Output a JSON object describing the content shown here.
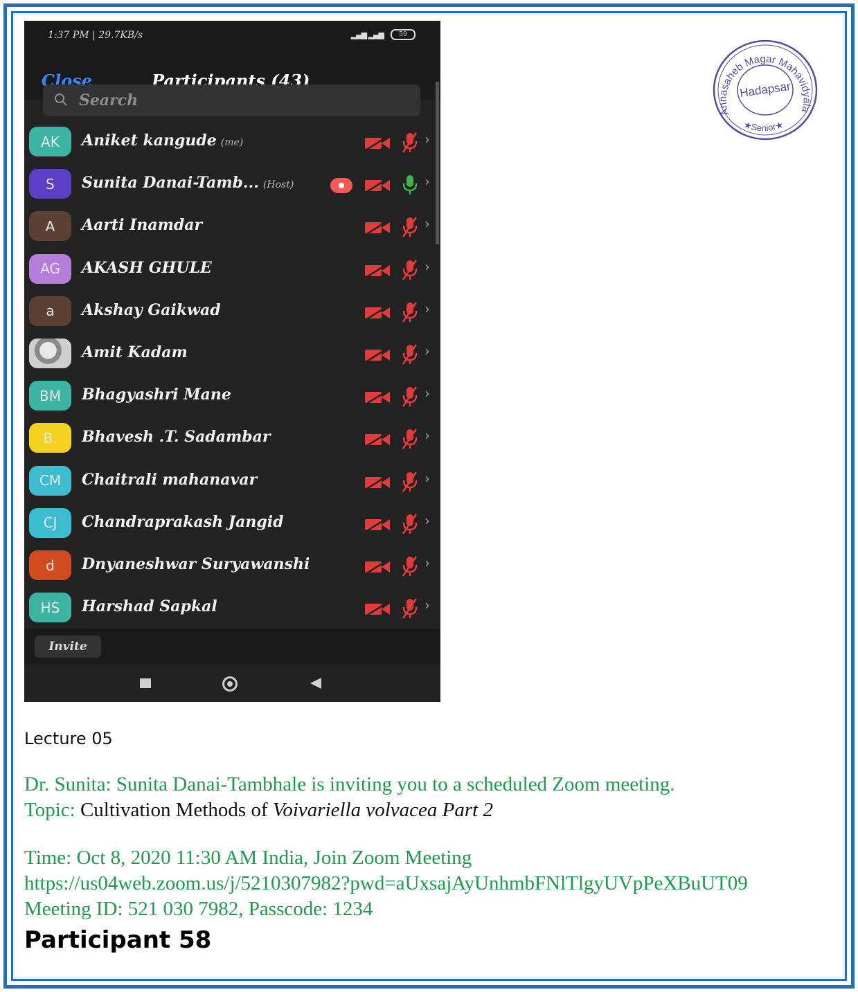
{
  "status_bar": {
    "time": "1:37 PM | 29.7KB/s",
    "signal": "▂▄▆ ▂▄▆",
    "battery": "59"
  },
  "header": {
    "close_label": "Close",
    "title": "Participants (43)"
  },
  "search": {
    "placeholder": "Search"
  },
  "participants": [
    {
      "initials": "AK",
      "name": "Aniket kangude",
      "tag": "(me)",
      "color": "#3db3a4",
      "mic": "muted",
      "video": "off"
    },
    {
      "initials": "S",
      "name": "Sunita Danai-Tamb...",
      "tag": "(Host)",
      "color": "#5b3fc8",
      "mic": "on",
      "video": "off",
      "recording": true
    },
    {
      "initials": "A",
      "name": "Aarti Inamdar",
      "tag": "",
      "color": "#5c4034",
      "mic": "muted",
      "video": "off"
    },
    {
      "initials": "AG",
      "name": "AKASH GHULE",
      "tag": "",
      "color": "#b57cd9",
      "mic": "muted",
      "video": "off"
    },
    {
      "initials": "a",
      "name": "Akshay Gaikwad",
      "tag": "",
      "color": "#5c4034",
      "mic": "muted",
      "video": "off"
    },
    {
      "initials": "",
      "name": "Amit Kadam",
      "tag": "",
      "color": "#9a9a9a",
      "photo": true,
      "mic": "muted",
      "video": "off"
    },
    {
      "initials": "BM",
      "name": "Bhagyashri Mane",
      "tag": "",
      "color": "#3db3a4",
      "mic": "muted",
      "video": "off"
    },
    {
      "initials": "B.",
      "name": "Bhavesh .T. Sadambar",
      "tag": "",
      "color": "#f4d21f",
      "mic": "muted",
      "video": "off"
    },
    {
      "initials": "CM",
      "name": "Chaitrali mahanavar",
      "tag": "",
      "color": "#3dbcd0",
      "mic": "muted",
      "video": "off"
    },
    {
      "initials": "CJ",
      "name": "Chandraprakash Jangid",
      "tag": "",
      "color": "#3dbcd0",
      "mic": "muted",
      "video": "off"
    },
    {
      "initials": "d",
      "name": "Dnyaneshwar Suryawanshi",
      "tag": "",
      "color": "#d24a1d",
      "mic": "muted",
      "video": "off"
    },
    {
      "initials": "HS",
      "name": "Harshad Sapkal",
      "tag": "",
      "color": "#3db3a4",
      "mic": "muted",
      "video": "off"
    }
  ],
  "footer": {
    "invite_label": "Invite"
  },
  "seal": {
    "arc_text": "Annasaheb Magar Mahavidyalaya",
    "center": "Hadapsar",
    "bottom": "★Senior★"
  },
  "caption": {
    "lecture": "Lecture 05",
    "invite_line": "Dr. Sunita: Sunita Danai-Tambhale is inviting you to a scheduled Zoom meeting.",
    "topic_label": "Topic:",
    "topic_text": "Cultivation Methods of",
    "topic_species": "Voivariella volvacea Part 2",
    "time_line": "Time: Oct 8, 2020 11:30 AM India, Join Zoom Meeting",
    "url": "https://us04web.zoom.us/j/5210307982?pwd=aUxsajAyUnhmbFNlTlgyUVpPeXBuUT09",
    "meeting_line": "Meeting ID: 521 030 7982, Passcode: 1234",
    "participant": "Participant 58"
  },
  "colors": {
    "frame_blue": "#1e6fc4",
    "text_green": "#1f9a4c",
    "muted_red": "#e23b3b",
    "mic_green": "#3fb54a",
    "seal_purple": "#5a4a9e"
  }
}
